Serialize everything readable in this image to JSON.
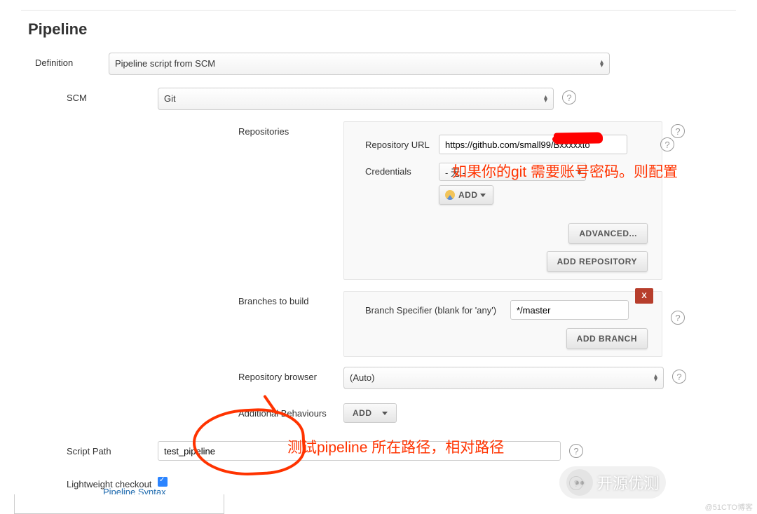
{
  "pipeline": {
    "title": "Pipeline",
    "definition_label": "Definition",
    "definition_value": "Pipeline script from SCM",
    "scm_label": "SCM",
    "scm_value": "Git",
    "repositories_label": "Repositories",
    "repo_url_label": "Repository URL",
    "repo_url_value": "https://github.com/small99/Bxxxxxto",
    "credentials_label": "Credentials",
    "credentials_value": "- 无 -",
    "add_credentials_label": "ADD",
    "advanced_label": "ADVANCED...",
    "add_repository_label": "ADD REPOSITORY",
    "branches_label": "Branches to build",
    "branch_spec_label": "Branch Specifier (blank for 'any')",
    "branch_spec_value": "*/master",
    "add_branch_label": "ADD BRANCH",
    "delete_branch_label": "X",
    "repo_browser_label": "Repository browser",
    "repo_browser_value": "(Auto)",
    "additional_behaviours_label": "Additional Behaviours",
    "additional_add_label": "ADD",
    "script_path_label": "Script Path",
    "script_path_value": "test_pipeline",
    "lightweight_label": "Lightweight checkout",
    "lightweight_checked": true,
    "pipeline_syntax_label": "Pipeline Syntax"
  },
  "annotations": {
    "git_note": "如果你的git 需要账号密码。则配置",
    "path_note": "测试pipeline 所在路径，相对路径"
  },
  "footer": {
    "watermark": "@51CTO博客",
    "badge": "开源优测"
  }
}
